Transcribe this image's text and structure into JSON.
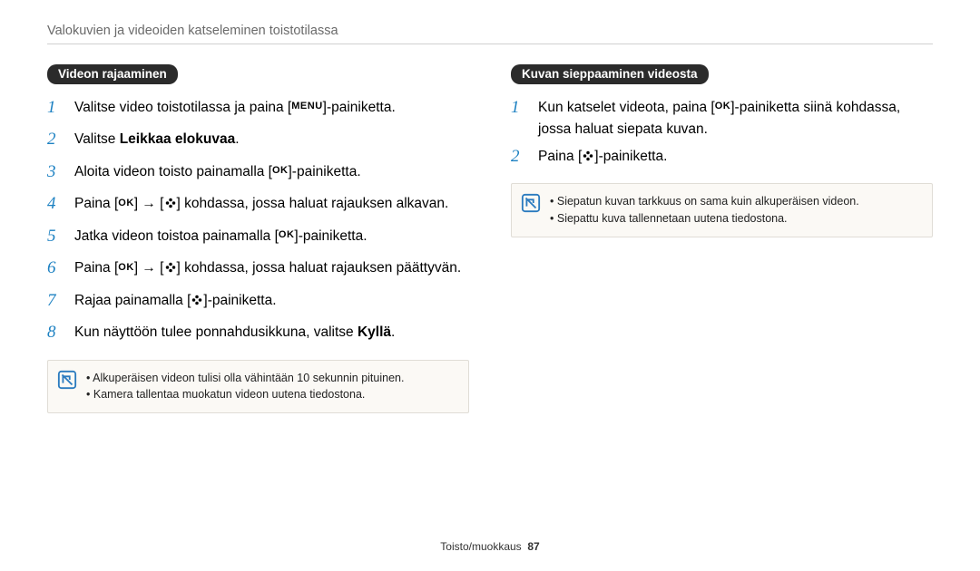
{
  "header": {
    "title": "Valokuvien ja videoiden katseleminen toistotilassa"
  },
  "left": {
    "label": "Videon rajaaminen",
    "steps": [
      {
        "pre": "Valitse video toistotilassa ja paina [",
        "icon": "MENU",
        "post": "]-painiketta."
      },
      {
        "pre": "Valitse ",
        "bold": "Leikkaa elokuvaa",
        "post": "."
      },
      {
        "pre": "Aloita videon toisto painamalla [",
        "icon": "OK",
        "post": "]-painiketta."
      },
      {
        "pre": "Paina [",
        "icon": "OK",
        "mid1": "] → [",
        "icon2": "FLOWER",
        "post": "] kohdassa, jossa haluat rajauksen alkavan."
      },
      {
        "pre": "Jatka videon toistoa painamalla [",
        "icon": "OK",
        "post": "]-painiketta."
      },
      {
        "pre": "Paina [",
        "icon": "OK",
        "mid1": "] → [",
        "icon2": "FLOWER",
        "post": "] kohdassa, jossa haluat rajauksen päättyvän."
      },
      {
        "pre": "Rajaa painamalla [",
        "icon": "FLOWER",
        "post": "]-painiketta."
      },
      {
        "pre": "Kun näyttöön tulee ponnahdusikkuna, valitse ",
        "bold": "Kyllä",
        "post": "."
      }
    ],
    "notes": [
      "Alkuperäisen videon tulisi olla vähintään 10 sekunnin pituinen.",
      "Kamera tallentaa muokatun videon uutena tiedostona."
    ]
  },
  "right": {
    "label": "Kuvan sieppaaminen videosta",
    "steps": [
      {
        "pre": "Kun katselet videota, paina [",
        "icon": "OK",
        "post": "]-painiketta siinä kohdassa, jossa haluat siepata kuvan."
      },
      {
        "pre": "Paina [",
        "icon": "FLOWER",
        "post": "]-painiketta."
      }
    ],
    "notes": [
      "Siepatun kuvan tarkkuus on sama kuin alkuperäisen videon.",
      "Siepattu kuva tallennetaan uutena tiedostona."
    ]
  },
  "footer": {
    "section": "Toisto/muokkaus",
    "page": "87"
  }
}
